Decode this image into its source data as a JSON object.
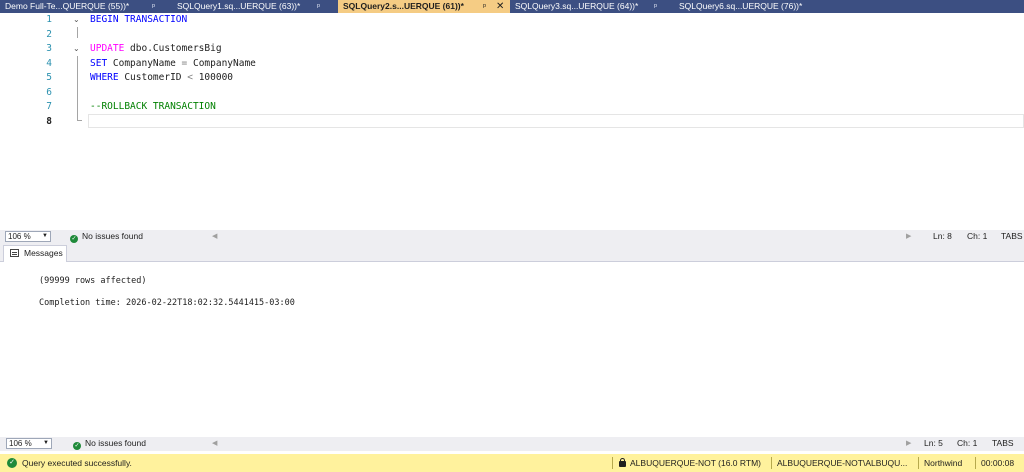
{
  "tabs": [
    {
      "label": "Demo Full-Te...QUERQUE (55))*",
      "active": false
    },
    {
      "label": "SQLQuery1.sq...UERQUE (63))*",
      "active": false
    },
    {
      "label": "SQLQuery2.s...UERQUE (61))*",
      "active": true
    },
    {
      "label": "SQLQuery3.sq...UERQUE (64))*",
      "active": false
    },
    {
      "label": "SQLQuery6.sq...UERQUE (76))*",
      "active": false
    }
  ],
  "tab_pin_glyph": "ᵖ",
  "tab_close_glyph": "✕",
  "editor": {
    "line_numbers": [
      "1",
      "2",
      "3",
      "4",
      "5",
      "6",
      "7",
      "8"
    ],
    "lines": {
      "l1_kw": "BEGIN TRANSACTION",
      "l3_kw": "UPDATE",
      "l3_rest": " dbo.CustomersBig",
      "l4_kw": "SET",
      "l4_ident1": " CompanyName ",
      "l4_op": "=",
      "l4_ident2": " CompanyName",
      "l5_kw": "WHERE",
      "l5_ident": " CustomerID ",
      "l5_op": "<",
      "l5_num": " 100000",
      "l7_cmt": "--ROLLBACK TRANSACTION"
    }
  },
  "editor_status": {
    "zoom": "106 %",
    "issues": "No issues found",
    "ln": "Ln: 8",
    "ch": "Ch: 1",
    "mode": "TABS"
  },
  "results": {
    "tab_label": "Messages",
    "messages": [
      "(99999 rows affected)",
      "Completion time: 2026-02-22T18:02:32.5441415-03:00"
    ]
  },
  "results_status": {
    "zoom": "106 %",
    "issues": "No issues found",
    "ln": "Ln: 5",
    "ch": "Ch: 1",
    "mode": "TABS"
  },
  "query_status": {
    "text": "Query executed successfully.",
    "server": "ALBUQUERQUE-NOT (16.0 RTM)",
    "login": "ALBUQUERQUE-NOT\\ALBUQU...",
    "database": "Northwind",
    "elapsed": "00:00:08"
  },
  "colors": {
    "tabstrip": "#3c4f82",
    "active_tab": "#f5cc84",
    "keyword": "#0000ff",
    "keyword_pink": "#ff00ff",
    "comment": "#008000",
    "line_number": "#2b91af",
    "status_bar": "#fff29d"
  }
}
